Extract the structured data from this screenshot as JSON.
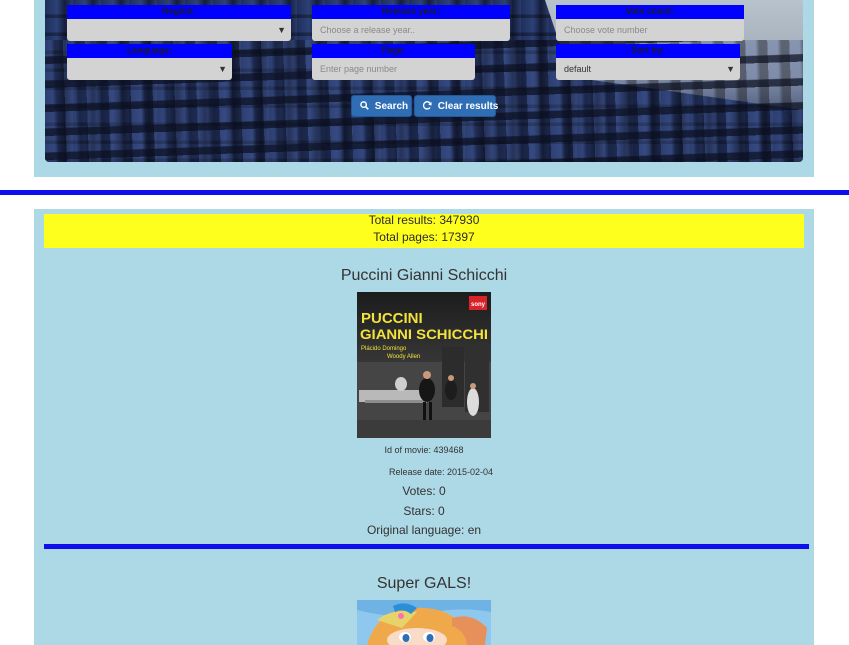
{
  "filters": {
    "region": {
      "label": "Region:",
      "value": ""
    },
    "release_year": {
      "label": "Release year:",
      "placeholder": "Choose a release year.."
    },
    "vote_count": {
      "label": "Vote count:",
      "placeholder": "Choose vote number"
    },
    "language": {
      "label": "Language:",
      "value": ""
    },
    "page": {
      "label": "Page:",
      "placeholder": "Enter page number"
    },
    "sort_by": {
      "label": "Sort by:",
      "value": "default"
    }
  },
  "buttons": {
    "search": "Search",
    "search_icon": "search-icon",
    "clear": "Clear results",
    "clear_icon": "refresh-icon"
  },
  "results": {
    "total_results": "Total results: 347930",
    "total_pages": "Total pages: 17397"
  },
  "movies": [
    {
      "title": "Puccini Gianni Schicchi",
      "poster": {
        "title_line1": "PUCCINI",
        "title_line2": "GIANNI SCHICCHI",
        "cast_line1": "Plácido Domingo",
        "cast_line2": "Woody Allen",
        "logo": "sony"
      },
      "id": "Id of movie: 439468",
      "release": "Release date: 2015-02-04",
      "votes": "Votes: 0",
      "stars": "Stars: 0",
      "language": "Original language: en"
    },
    {
      "title": "Super GALS!"
    }
  ],
  "colors": {
    "panel": "#add8e6",
    "label_bar": "#0000ff",
    "totals_bg": "#ffff1e",
    "button": "#2f6db5",
    "divider": "#0f0fee"
  }
}
